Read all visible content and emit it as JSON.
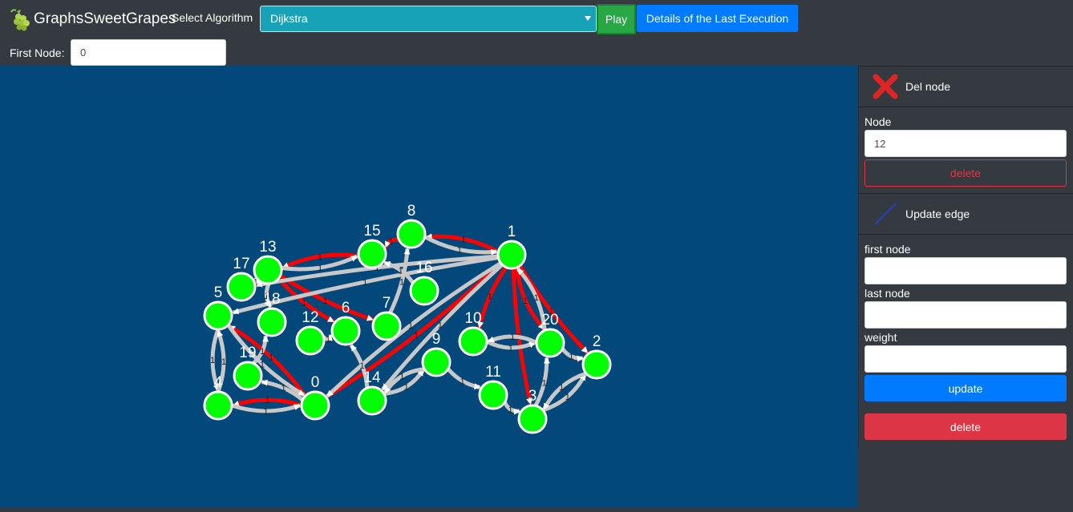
{
  "app": {
    "title": "GraphsSweetGrapes"
  },
  "toolbar": {
    "algorithm_label": "Select Algorithm",
    "algorithm_selected": "Dijkstra",
    "play_label": "Play",
    "details_label": "Details of the Last Execution",
    "first_node_label": "First Node:",
    "first_node_value": "0"
  },
  "panel": {
    "del_node": {
      "title": "Del node",
      "node_label": "Node",
      "node_value": "12",
      "delete_label": "delete"
    },
    "update_edge": {
      "title": "Update edge",
      "first_node_label": "first node",
      "last_node_label": "last node",
      "weight_label": "weight",
      "update_label": "update",
      "delete_label": "delete"
    }
  },
  "colors": {
    "canvas_bg": "#03487b",
    "node_fill": "#00ff00",
    "edge_default": "#c8c8c8",
    "edge_highlight": "#ff0000",
    "select_bg": "#17a2b8"
  },
  "graph": {
    "nodes": [
      {
        "id": "0",
        "label": "0"
      },
      {
        "id": "1",
        "label": "1"
      },
      {
        "id": "2",
        "label": "2"
      },
      {
        "id": "3",
        "label": "3"
      },
      {
        "id": "4",
        "label": "4"
      },
      {
        "id": "5",
        "label": "5"
      },
      {
        "id": "6",
        "label": "6"
      },
      {
        "id": "7",
        "label": "7"
      },
      {
        "id": "8",
        "label": "8"
      },
      {
        "id": "9",
        "label": "9"
      },
      {
        "id": "10",
        "label": "10"
      },
      {
        "id": "11",
        "label": "11"
      },
      {
        "id": "12",
        "label": "12"
      },
      {
        "id": "13",
        "label": "13"
      },
      {
        "id": "14",
        "label": "14"
      },
      {
        "id": "15",
        "label": "15"
      },
      {
        "id": "16",
        "label": "16"
      },
      {
        "id": "17",
        "label": "17"
      },
      {
        "id": "18",
        "label": "18"
      },
      {
        "id": "19",
        "label": "19"
      },
      {
        "id": "20",
        "label": "20"
      }
    ],
    "edges": [
      {
        "from": "0",
        "to": "4",
        "weight": "1",
        "highlight": true
      },
      {
        "from": "0",
        "to": "5",
        "weight": "1",
        "highlight": true
      },
      {
        "from": "0",
        "to": "1",
        "weight": "1",
        "highlight": true
      },
      {
        "from": "1",
        "to": "8",
        "weight": "1",
        "highlight": true
      },
      {
        "from": "1",
        "to": "10",
        "weight": "1",
        "highlight": true
      },
      {
        "from": "1",
        "to": "3",
        "weight": "1",
        "highlight": true
      },
      {
        "from": "1",
        "to": "2",
        "weight": "1",
        "highlight": true
      },
      {
        "from": "1",
        "to": "20",
        "weight": "1",
        "highlight": true
      },
      {
        "from": "8",
        "to": "15",
        "weight": "1",
        "highlight": true
      },
      {
        "from": "15",
        "to": "13",
        "weight": "1",
        "highlight": true
      },
      {
        "from": "13",
        "to": "6",
        "weight": "1",
        "highlight": true
      },
      {
        "from": "13",
        "to": "7",
        "weight": "1",
        "highlight": true
      },
      {
        "from": "8",
        "to": "1",
        "weight": "1",
        "highlight": false
      },
      {
        "from": "13",
        "to": "15",
        "weight": "1",
        "highlight": false
      },
      {
        "from": "1",
        "to": "17",
        "weight": "1",
        "highlight": false
      },
      {
        "from": "1",
        "to": "5",
        "weight": "1",
        "highlight": false
      },
      {
        "from": "1",
        "to": "0",
        "weight": "1",
        "highlight": false
      },
      {
        "from": "1",
        "to": "14",
        "weight": "1",
        "highlight": false
      },
      {
        "from": "16",
        "to": "15",
        "weight": "1",
        "highlight": false
      },
      {
        "from": "7",
        "to": "8",
        "weight": "1",
        "highlight": false
      },
      {
        "from": "5",
        "to": "0",
        "weight": "1",
        "highlight": false
      },
      {
        "from": "4",
        "to": "0",
        "weight": "1",
        "highlight": false
      },
      {
        "from": "5",
        "to": "4",
        "weight": "1",
        "highlight": false
      },
      {
        "from": "4",
        "to": "5",
        "weight": "1",
        "highlight": false
      },
      {
        "from": "19",
        "to": "18",
        "weight": "1",
        "highlight": false
      },
      {
        "from": "13",
        "to": "18",
        "weight": "1",
        "highlight": false
      },
      {
        "from": "12",
        "to": "6",
        "weight": "1",
        "highlight": false
      },
      {
        "from": "14",
        "to": "6",
        "weight": "1",
        "highlight": false
      },
      {
        "from": "14",
        "to": "9",
        "weight": "1",
        "highlight": false
      },
      {
        "from": "9",
        "to": "14",
        "weight": "1",
        "highlight": false
      },
      {
        "from": "9",
        "to": "11",
        "weight": "1",
        "highlight": false
      },
      {
        "from": "11",
        "to": "3",
        "weight": "1",
        "highlight": false
      },
      {
        "from": "3",
        "to": "2",
        "weight": "1",
        "highlight": false
      },
      {
        "from": "2",
        "to": "3",
        "weight": "1",
        "highlight": false
      },
      {
        "from": "10",
        "to": "20",
        "weight": "1",
        "highlight": false
      },
      {
        "from": "20",
        "to": "10",
        "weight": "1",
        "highlight": false
      },
      {
        "from": "20",
        "to": "2",
        "weight": "1",
        "highlight": false
      },
      {
        "from": "20",
        "to": "1",
        "weight": "1",
        "highlight": false
      },
      {
        "from": "3",
        "to": "20",
        "weight": "1",
        "highlight": false
      },
      {
        "from": "0",
        "to": "19",
        "weight": "1",
        "highlight": false
      },
      {
        "from": "17",
        "to": "13",
        "weight": "1",
        "highlight": false
      }
    ]
  }
}
